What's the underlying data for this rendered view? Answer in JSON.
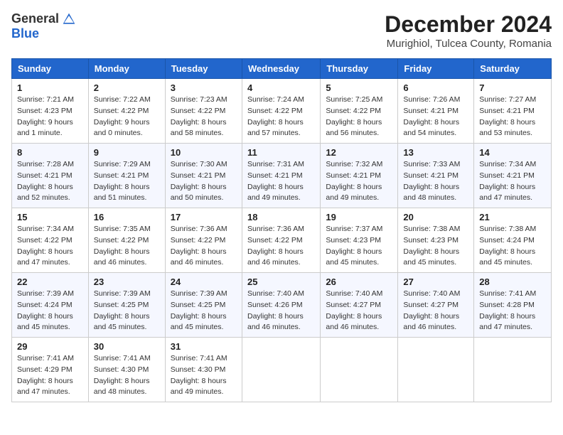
{
  "logo": {
    "general": "General",
    "blue": "Blue"
  },
  "title": "December 2024",
  "subtitle": "Murighiol, Tulcea County, Romania",
  "header": {
    "days": [
      "Sunday",
      "Monday",
      "Tuesday",
      "Wednesday",
      "Thursday",
      "Friday",
      "Saturday"
    ]
  },
  "weeks": [
    [
      {
        "day": "1",
        "sunrise": "7:21 AM",
        "sunset": "4:23 PM",
        "daylight": "9 hours and 1 minute."
      },
      {
        "day": "2",
        "sunrise": "7:22 AM",
        "sunset": "4:22 PM",
        "daylight": "9 hours and 0 minutes."
      },
      {
        "day": "3",
        "sunrise": "7:23 AM",
        "sunset": "4:22 PM",
        "daylight": "8 hours and 58 minutes."
      },
      {
        "day": "4",
        "sunrise": "7:24 AM",
        "sunset": "4:22 PM",
        "daylight": "8 hours and 57 minutes."
      },
      {
        "day": "5",
        "sunrise": "7:25 AM",
        "sunset": "4:22 PM",
        "daylight": "8 hours and 56 minutes."
      },
      {
        "day": "6",
        "sunrise": "7:26 AM",
        "sunset": "4:21 PM",
        "daylight": "8 hours and 54 minutes."
      },
      {
        "day": "7",
        "sunrise": "7:27 AM",
        "sunset": "4:21 PM",
        "daylight": "8 hours and 53 minutes."
      }
    ],
    [
      {
        "day": "8",
        "sunrise": "7:28 AM",
        "sunset": "4:21 PM",
        "daylight": "8 hours and 52 minutes."
      },
      {
        "day": "9",
        "sunrise": "7:29 AM",
        "sunset": "4:21 PM",
        "daylight": "8 hours and 51 minutes."
      },
      {
        "day": "10",
        "sunrise": "7:30 AM",
        "sunset": "4:21 PM",
        "daylight": "8 hours and 50 minutes."
      },
      {
        "day": "11",
        "sunrise": "7:31 AM",
        "sunset": "4:21 PM",
        "daylight": "8 hours and 49 minutes."
      },
      {
        "day": "12",
        "sunrise": "7:32 AM",
        "sunset": "4:21 PM",
        "daylight": "8 hours and 49 minutes."
      },
      {
        "day": "13",
        "sunrise": "7:33 AM",
        "sunset": "4:21 PM",
        "daylight": "8 hours and 48 minutes."
      },
      {
        "day": "14",
        "sunrise": "7:34 AM",
        "sunset": "4:21 PM",
        "daylight": "8 hours and 47 minutes."
      }
    ],
    [
      {
        "day": "15",
        "sunrise": "7:34 AM",
        "sunset": "4:22 PM",
        "daylight": "8 hours and 47 minutes."
      },
      {
        "day": "16",
        "sunrise": "7:35 AM",
        "sunset": "4:22 PM",
        "daylight": "8 hours and 46 minutes."
      },
      {
        "day": "17",
        "sunrise": "7:36 AM",
        "sunset": "4:22 PM",
        "daylight": "8 hours and 46 minutes."
      },
      {
        "day": "18",
        "sunrise": "7:36 AM",
        "sunset": "4:22 PM",
        "daylight": "8 hours and 46 minutes."
      },
      {
        "day": "19",
        "sunrise": "7:37 AM",
        "sunset": "4:23 PM",
        "daylight": "8 hours and 45 minutes."
      },
      {
        "day": "20",
        "sunrise": "7:38 AM",
        "sunset": "4:23 PM",
        "daylight": "8 hours and 45 minutes."
      },
      {
        "day": "21",
        "sunrise": "7:38 AM",
        "sunset": "4:24 PM",
        "daylight": "8 hours and 45 minutes."
      }
    ],
    [
      {
        "day": "22",
        "sunrise": "7:39 AM",
        "sunset": "4:24 PM",
        "daylight": "8 hours and 45 minutes."
      },
      {
        "day": "23",
        "sunrise": "7:39 AM",
        "sunset": "4:25 PM",
        "daylight": "8 hours and 45 minutes."
      },
      {
        "day": "24",
        "sunrise": "7:39 AM",
        "sunset": "4:25 PM",
        "daylight": "8 hours and 45 minutes."
      },
      {
        "day": "25",
        "sunrise": "7:40 AM",
        "sunset": "4:26 PM",
        "daylight": "8 hours and 46 minutes."
      },
      {
        "day": "26",
        "sunrise": "7:40 AM",
        "sunset": "4:27 PM",
        "daylight": "8 hours and 46 minutes."
      },
      {
        "day": "27",
        "sunrise": "7:40 AM",
        "sunset": "4:27 PM",
        "daylight": "8 hours and 46 minutes."
      },
      {
        "day": "28",
        "sunrise": "7:41 AM",
        "sunset": "4:28 PM",
        "daylight": "8 hours and 47 minutes."
      }
    ],
    [
      {
        "day": "29",
        "sunrise": "7:41 AM",
        "sunset": "4:29 PM",
        "daylight": "8 hours and 47 minutes."
      },
      {
        "day": "30",
        "sunrise": "7:41 AM",
        "sunset": "4:30 PM",
        "daylight": "8 hours and 48 minutes."
      },
      {
        "day": "31",
        "sunrise": "7:41 AM",
        "sunset": "4:30 PM",
        "daylight": "8 hours and 49 minutes."
      },
      null,
      null,
      null,
      null
    ]
  ]
}
